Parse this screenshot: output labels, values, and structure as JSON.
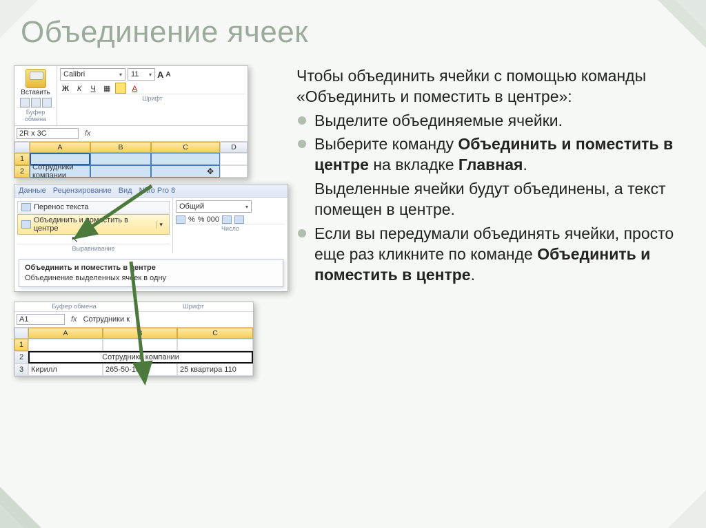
{
  "title": "Объединение ячеек",
  "intro": "Чтобы объединить ячейки с помощью команды «Объединить и поместить в центре»:",
  "bullets": {
    "b1": "Выделите объединяемые ячейки.",
    "b2_pre": "Выберите команду ",
    "b2_cmd": "Объединить и поместить в центре",
    "b2_mid": " на вкладке ",
    "b2_tab": "Главная",
    "b2_post": ".",
    "b3": "Выделенные ячейки будут объединены, а текст помещен в центре.",
    "b4_pre": "Если вы передумали объединять ячейки, просто еще раз кликните по команде ",
    "b4_cmd": "Объединить и поместить в центре",
    "b4_post": "."
  },
  "shot1": {
    "paste": "Вставить",
    "clipboard_grp": "Буфер обмена",
    "font_name": "Calibri",
    "font_size": "11",
    "font_grp": "Шрифт",
    "namebox": "2R x 3C",
    "cols": {
      "A": "A",
      "B": "B",
      "C": "C",
      "D": "D"
    },
    "rows": {
      "r1": "1",
      "r2": "2"
    },
    "cell_a2": "Сотрудники компании"
  },
  "shot2": {
    "tabs": {
      "t1": "Данные",
      "t2": "Рецензирование",
      "t3": "Вид",
      "t4": "Nitro Pro 8"
    },
    "wrap": "Перенос текста",
    "merge": "Объединить и поместить в центре",
    "align_grp": "Выравнивание",
    "num_format": "Общий",
    "num_sample": "% 000",
    "num_grp": "Число",
    "tooltip_title": "Объединить и поместить в центре",
    "tooltip_body": "Объединение выделенных ячеек в одну"
  },
  "shot3": {
    "grp_left": "Буфер обмена",
    "grp_right": "Шрифт",
    "namebox": "A1",
    "formula_val": "Сотрудники к",
    "cols": {
      "A": "A",
      "B": "B",
      "C": "C"
    },
    "rows": {
      "r1": "1",
      "r2": "2",
      "r3": "3"
    },
    "merged_text": "Сотрудники компании",
    "r3_a": "Кирилл",
    "r3_b": "265-50-18",
    "r3_c": "25 квартира 110"
  }
}
